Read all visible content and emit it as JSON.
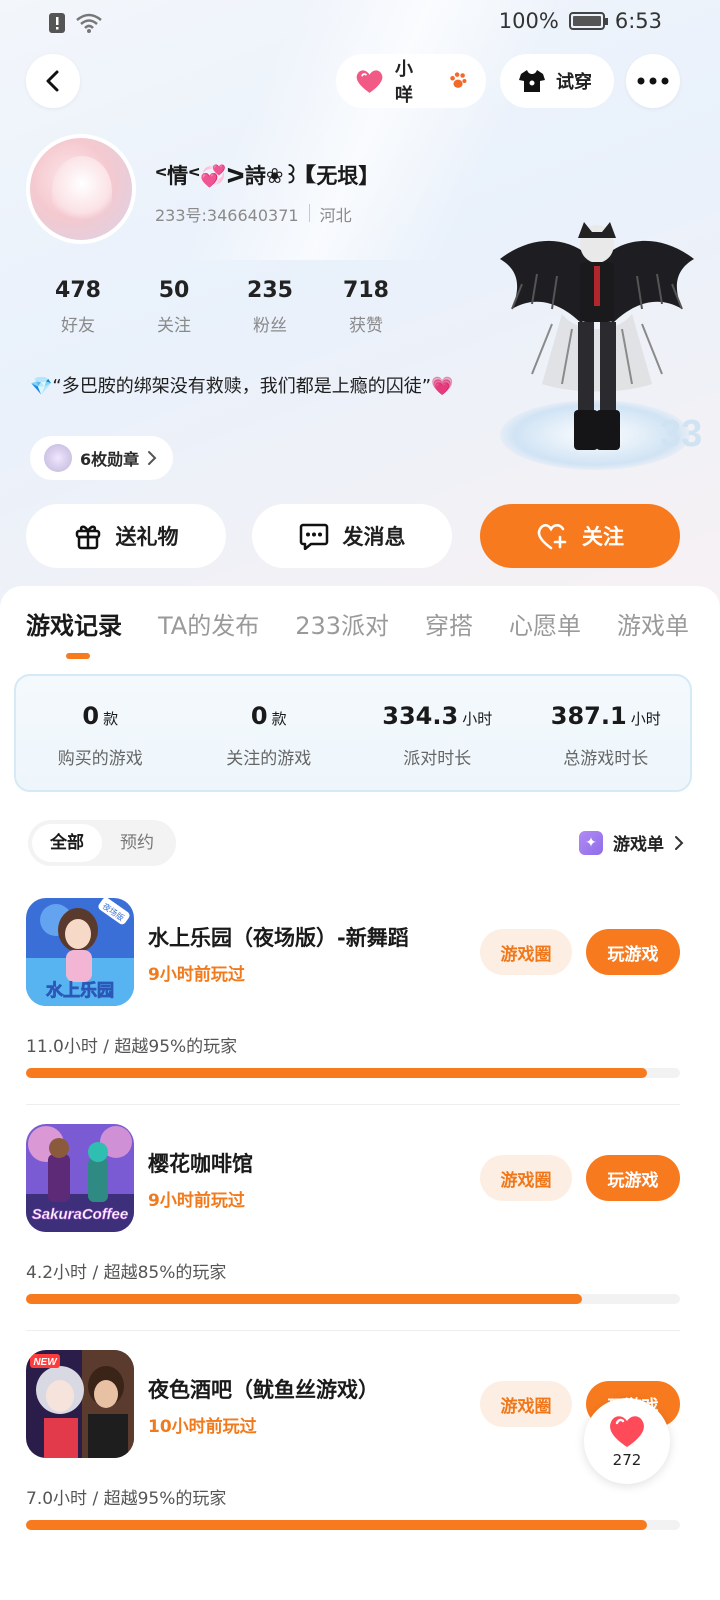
{
  "status_bar": {
    "battery_percent": "100%",
    "time": "6:53",
    "icons": [
      "alert-icon",
      "wifi-icon",
      "battery-icon"
    ]
  },
  "header": {
    "back_icon": "back-arrow-icon",
    "pet_button": {
      "label": "小咩",
      "icons": [
        "heart-icon",
        "paw-icon"
      ]
    },
    "tryon_button": {
      "label": "试穿",
      "icon": "tshirt-icon"
    },
    "more_icon": "more-dots-icon"
  },
  "profile": {
    "name": "ᑉ情ᑉ💞ᐳ詩❀꒱【无垠】",
    "id_label": "233号:346640371",
    "region": "河北",
    "stats": [
      {
        "value": "478",
        "label": "好友"
      },
      {
        "value": "50",
        "label": "关注"
      },
      {
        "value": "235",
        "label": "粉丝"
      },
      {
        "value": "718",
        "label": "获赞"
      }
    ],
    "bio": "💎“多巴胺的绑架没有救赎，我们都是上瘾的囚徒”💗",
    "medals_label": "6枚勋章"
  },
  "actions": {
    "gift": "送礼物",
    "message": "发消息",
    "follow": "关注"
  },
  "tabs": [
    "游戏记录",
    "TA的发布",
    "233派对",
    "穿搭",
    "心愿单",
    "游戏单"
  ],
  "active_tab": "游戏记录",
  "summary": [
    {
      "value": "0",
      "unit": "款",
      "label": "购买的游戏"
    },
    {
      "value": "0",
      "unit": "款",
      "label": "关注的游戏"
    },
    {
      "value": "334.3",
      "unit": "小时",
      "label": "派对时长"
    },
    {
      "value": "387.1",
      "unit": "小时",
      "label": "总游戏时长"
    }
  ],
  "filter": {
    "all": "全部",
    "reserve": "预约",
    "game_list_link": "游戏单"
  },
  "games": [
    {
      "name": "水上乐园（夜场版）-新舞蹈",
      "last_played": "9小时前玩过",
      "stat": "11.0小时 / 超越95%的玩家",
      "progress": 0.95,
      "circle_btn": "游戏圈",
      "play_btn": "玩游戏",
      "icon_text": "水上乐园",
      "badge": "夜场版"
    },
    {
      "name": "樱花咖啡馆",
      "last_played": "9小时前玩过",
      "stat": "4.2小时 / 超越85%的玩家",
      "progress": 0.85,
      "circle_btn": "游戏圈",
      "play_btn": "玩游戏",
      "icon_text": "SakuraCoffee"
    },
    {
      "name": "夜色酒吧（鱿鱼丝游戏）",
      "last_played": "10小时前玩过",
      "stat": "7.0小时 / 超越95%的玩家",
      "progress": 0.95,
      "circle_btn": "游戏圈",
      "play_btn": "玩游戏",
      "badge": "NEW"
    }
  ],
  "float_like": {
    "count": "272",
    "icon": "heart-icon"
  },
  "colors": {
    "accent": "#f87a1f",
    "accent_soft": "#fdeee3",
    "text_orange": "#f07a1c"
  }
}
